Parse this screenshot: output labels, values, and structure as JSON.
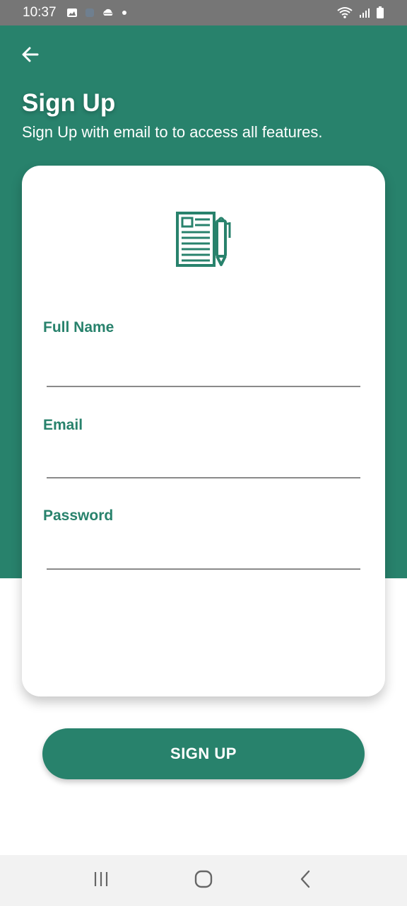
{
  "status_bar": {
    "time": "10:37",
    "icons_left": [
      "image-icon",
      "app-icon",
      "cloud-icon",
      "dot-icon"
    ],
    "icons_right": [
      "wifi-icon",
      "signal-icon",
      "battery-icon"
    ]
  },
  "header": {
    "back_icon": "arrow-left-icon",
    "title": "Sign Up",
    "subtitle": "Sign Up with email to to access all features."
  },
  "form": {
    "icon": "document-pen-icon",
    "fields": [
      {
        "label": "Full Name",
        "value": ""
      },
      {
        "label": "Email",
        "value": ""
      },
      {
        "label": "Password",
        "value": ""
      }
    ]
  },
  "actions": {
    "signup_label": "SIGN UP"
  },
  "nav_bar": {
    "buttons": [
      "recents-icon",
      "home-icon",
      "back-icon"
    ]
  },
  "colors": {
    "primary": "#28826c",
    "status_bar": "#767676",
    "nav_bar": "#f2f2f2",
    "card": "#ffffff"
  }
}
